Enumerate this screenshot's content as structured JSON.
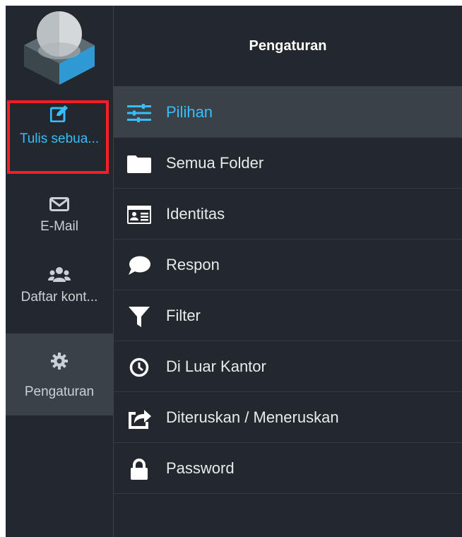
{
  "sidebar": {
    "compose": {
      "label": "Tulis sebua...",
      "icon": "compose-icon"
    },
    "mail": {
      "label": "E-Mail",
      "icon": "envelope-icon"
    },
    "contacts": {
      "label": "Daftar kont...",
      "icon": "users-icon"
    },
    "settings": {
      "label": "Pengaturan",
      "icon": "gear-icon"
    }
  },
  "panel": {
    "title": "Pengaturan",
    "items": [
      {
        "label": "Pilihan",
        "icon": "sliders-icon",
        "active": true
      },
      {
        "label": "Semua Folder",
        "icon": "folder-icon"
      },
      {
        "label": "Identitas",
        "icon": "id-card-icon"
      },
      {
        "label": "Respon",
        "icon": "speech-bubble-icon"
      },
      {
        "label": "Filter",
        "icon": "filter-icon"
      },
      {
        "label": "Di Luar Kantor",
        "icon": "clock-icon"
      },
      {
        "label": "Diteruskan / Meneruskan",
        "icon": "forward-icon"
      },
      {
        "label": "Password",
        "icon": "lock-icon"
      }
    ]
  },
  "colors": {
    "background": "#22282d",
    "active_background": "#3a4248",
    "accent": "#37beff",
    "highlight_border": "#ff1c25",
    "text": "#e6ebee"
  }
}
